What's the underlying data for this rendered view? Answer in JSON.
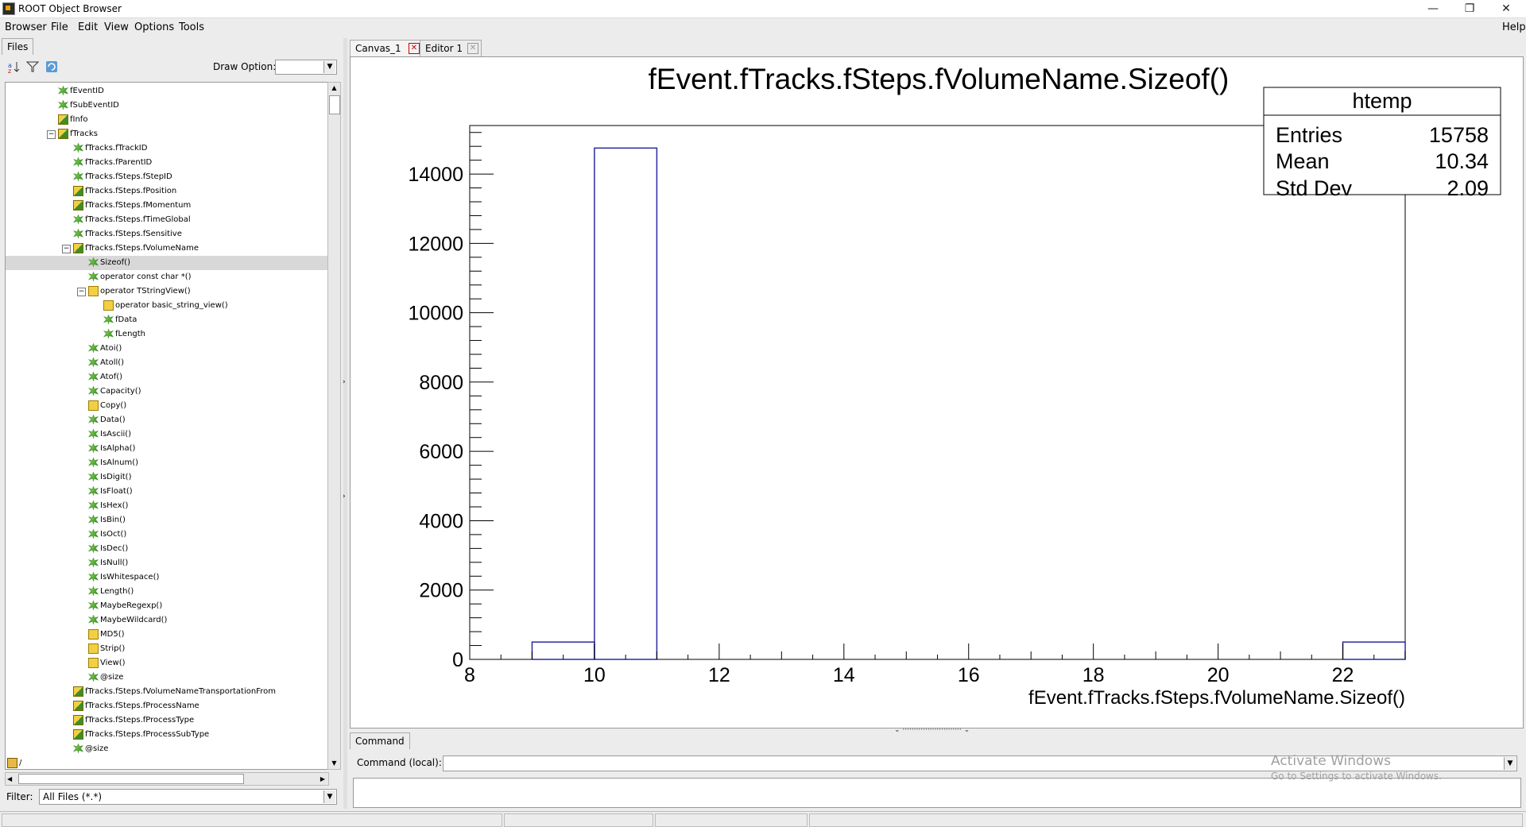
{
  "window": {
    "title": "ROOT Object Browser",
    "buttons": [
      "—",
      "❐",
      "✕"
    ]
  },
  "menubar": {
    "left": [
      "Browser",
      "File",
      "Edit",
      "View",
      "Options",
      "Tools"
    ],
    "help": "Help"
  },
  "left": {
    "tab": "Files",
    "draw_option_label": "Draw Option:",
    "draw_option_value": "",
    "filter_label": "Filter:",
    "filter_value": "All Files (*.*)",
    "tree": [
      {
        "label": "fEventID",
        "icon": "green",
        "indent": 0
      },
      {
        "label": "fSubEventID",
        "icon": "green",
        "indent": 0
      },
      {
        "label": "fInfo",
        "icon": "yellowgreen",
        "indent": 0
      },
      {
        "label": "fTracks",
        "icon": "yellowgreen",
        "indent": 0,
        "expanded": true
      },
      {
        "label": "fTracks.fTrackID",
        "icon": "green",
        "indent": 1
      },
      {
        "label": "fTracks.fParentID",
        "icon": "green",
        "indent": 1
      },
      {
        "label": "fTracks.fSteps.fStepID",
        "icon": "green",
        "indent": 1
      },
      {
        "label": "fTracks.fSteps.fPosition",
        "icon": "yellowgreen",
        "indent": 1
      },
      {
        "label": "fTracks.fSteps.fMomentum",
        "icon": "yellowgreen",
        "indent": 1
      },
      {
        "label": "fTracks.fSteps.fTimeGlobal",
        "icon": "green",
        "indent": 1
      },
      {
        "label": "fTracks.fSteps.fSensitive",
        "icon": "green",
        "indent": 1
      },
      {
        "label": "fTracks.fSteps.fVolumeName",
        "icon": "yellowgreen",
        "indent": 1,
        "expanded": true
      },
      {
        "label": "Sizeof()",
        "icon": "green",
        "indent": 2,
        "selected": true
      },
      {
        "label": "operator const char *()",
        "icon": "green",
        "indent": 2
      },
      {
        "label": "operator TStringView()",
        "icon": "yellow",
        "indent": 2,
        "expanded": true
      },
      {
        "label": "operator basic_string_view()",
        "icon": "yellow",
        "indent": 3
      },
      {
        "label": "fData",
        "icon": "green",
        "indent": 3
      },
      {
        "label": "fLength",
        "icon": "green",
        "indent": 3
      },
      {
        "label": "Atoi()",
        "icon": "green",
        "indent": 2
      },
      {
        "label": "Atoll()",
        "icon": "green",
        "indent": 2
      },
      {
        "label": "Atof()",
        "icon": "green",
        "indent": 2
      },
      {
        "label": "Capacity()",
        "icon": "green",
        "indent": 2
      },
      {
        "label": "Copy()",
        "icon": "yellow",
        "indent": 2
      },
      {
        "label": "Data()",
        "icon": "green",
        "indent": 2
      },
      {
        "label": "IsAscii()",
        "icon": "green",
        "indent": 2
      },
      {
        "label": "IsAlpha()",
        "icon": "green",
        "indent": 2
      },
      {
        "label": "IsAlnum()",
        "icon": "green",
        "indent": 2
      },
      {
        "label": "IsDigit()",
        "icon": "green",
        "indent": 2
      },
      {
        "label": "IsFloat()",
        "icon": "green",
        "indent": 2
      },
      {
        "label": "IsHex()",
        "icon": "green",
        "indent": 2
      },
      {
        "label": "IsBin()",
        "icon": "green",
        "indent": 2
      },
      {
        "label": "IsOct()",
        "icon": "green",
        "indent": 2
      },
      {
        "label": "IsDec()",
        "icon": "green",
        "indent": 2
      },
      {
        "label": "IsNull()",
        "icon": "green",
        "indent": 2
      },
      {
        "label": "IsWhitespace()",
        "icon": "green",
        "indent": 2
      },
      {
        "label": "Length()",
        "icon": "green",
        "indent": 2
      },
      {
        "label": "MaybeRegexp()",
        "icon": "green",
        "indent": 2
      },
      {
        "label": "MaybeWildcard()",
        "icon": "green",
        "indent": 2
      },
      {
        "label": "MD5()",
        "icon": "yellow",
        "indent": 2
      },
      {
        "label": "Strip()",
        "icon": "yellow",
        "indent": 2
      },
      {
        "label": "View()",
        "icon": "yellow",
        "indent": 2
      },
      {
        "label": "@size",
        "icon": "green",
        "indent": 2
      },
      {
        "label": "fTracks.fSteps.fVolumeNameTransportationFrom",
        "icon": "yellowgreen",
        "indent": 1
      },
      {
        "label": "fTracks.fSteps.fProcessName",
        "icon": "yellowgreen",
        "indent": 1
      },
      {
        "label": "fTracks.fSteps.fProcessType",
        "icon": "yellowgreen",
        "indent": 1
      },
      {
        "label": "fTracks.fSteps.fProcessSubType",
        "icon": "yellowgreen",
        "indent": 1
      },
      {
        "label": "@size",
        "icon": "green",
        "indent": 1
      },
      {
        "label": "/",
        "icon": "folder",
        "indent": -1
      }
    ]
  },
  "right": {
    "tabs": [
      "Canvas_1",
      "Editor 1"
    ],
    "command_tab": "Command",
    "command_label": "Command (local):",
    "command_value": "",
    "watermark_title": "Activate Windows",
    "watermark_sub": "Go to Settings to activate Windows."
  },
  "stats": {
    "title": "htemp",
    "rows": [
      [
        "Entries",
        "15758"
      ],
      [
        "Mean",
        "10.34"
      ],
      [
        "Std Dev",
        "2.09"
      ]
    ]
  },
  "chart_data": {
    "type": "bar",
    "title": "fEvent.fTracks.fSteps.fVolumeName.Sizeof()",
    "xlabel": "fEvent.fTracks.fSteps.fVolumeName.Sizeof()",
    "ylabel": "",
    "xlim": [
      8,
      23
    ],
    "ylim": [
      0,
      15400
    ],
    "bins": [
      {
        "x0": 9,
        "x1": 10,
        "value": 500
      },
      {
        "x0": 10,
        "x1": 11,
        "value": 14750
      },
      {
        "x0": 11,
        "x1": 22,
        "value": 0
      },
      {
        "x0": 22,
        "x1": 23,
        "value": 500
      }
    ],
    "xticks": [
      8,
      10,
      12,
      14,
      16,
      18,
      20,
      22
    ],
    "yticks": [
      0,
      2000,
      4000,
      6000,
      8000,
      10000,
      12000,
      14000
    ],
    "bar_color": "#2a2a9e",
    "grid": false
  }
}
